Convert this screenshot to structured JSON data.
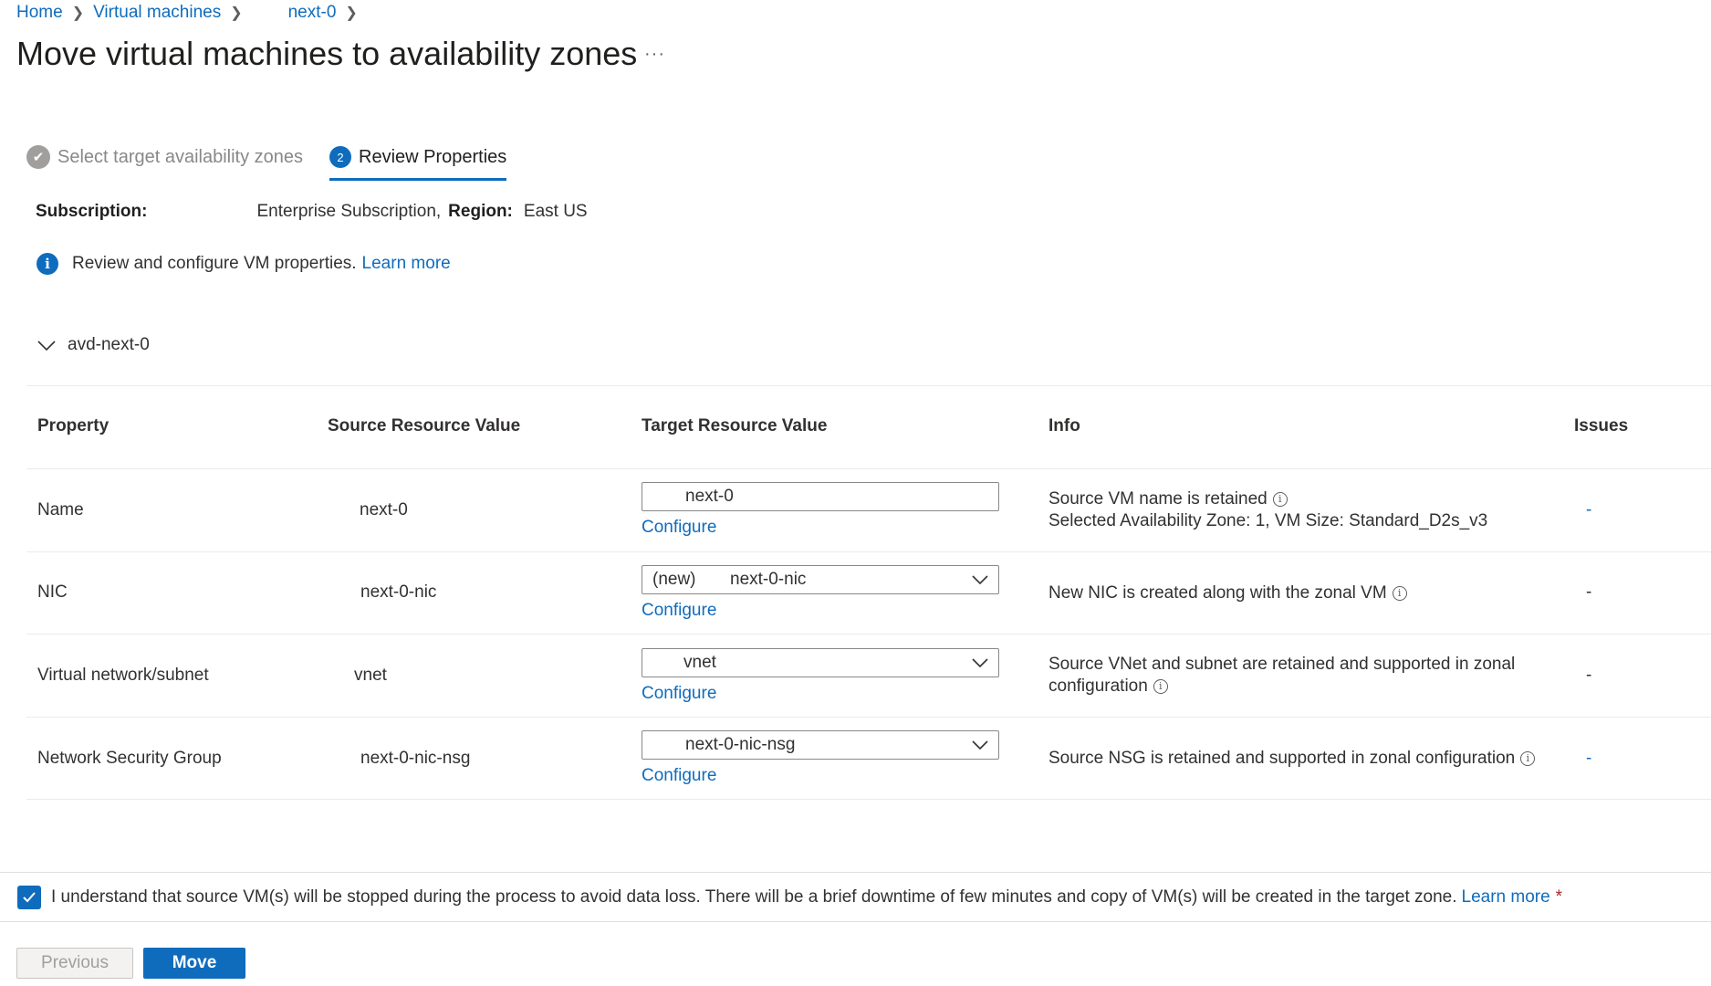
{
  "breadcrumb": {
    "home": "Home",
    "virtual_machines": "Virtual machines",
    "vm": "next-0"
  },
  "page": {
    "title": "Move virtual machines to availability zones",
    "more": "···"
  },
  "wizard": {
    "step1": {
      "label": "Select target availability zones",
      "status": "completed"
    },
    "step2": {
      "label": "Review Properties",
      "number": "2",
      "status": "active"
    }
  },
  "subscription": {
    "label": "Subscription:",
    "value": "Enterprise Subscription,",
    "region_label": "Region:",
    "region_value": "East US"
  },
  "info_banner": {
    "text": "Review and configure VM properties.",
    "link": "Learn more"
  },
  "group": {
    "name": "avd-next-0"
  },
  "table": {
    "headers": {
      "property": "Property",
      "source": "Source Resource Value",
      "target": "Target Resource Value",
      "info": "Info",
      "issues": "Issues"
    },
    "configure_label": "Configure",
    "rows": [
      {
        "property": "Name",
        "source": "next-0",
        "target_value": "next-0",
        "target_prefix": "",
        "info_line1": "Source VM name is retained",
        "info_line2": "Selected Availability Zone: 1, VM Size: Standard_D2s_v3",
        "issues": "-"
      },
      {
        "property": "NIC",
        "source": "next-0-nic",
        "target_value": "next-0-nic",
        "target_prefix": "(new)",
        "info_line1": "New NIC is created along with the zonal VM",
        "info_line2": "",
        "issues": "-"
      },
      {
        "property": "Virtual network/subnet",
        "source": "vnet",
        "target_value": "vnet",
        "target_prefix": "",
        "info_line1": "Source VNet and subnet are retained and supported in zonal",
        "info_line2": "configuration",
        "issues": "-"
      },
      {
        "property": "Network Security Group",
        "source": "next-0-nic-nsg",
        "target_value": "next-0-nic-nsg",
        "target_prefix": "",
        "info_line1": "Source NSG is retained and supported in zonal configuration",
        "info_line2": "",
        "issues": "-"
      }
    ]
  },
  "footer": {
    "acknowledgement": "I understand that source VM(s) will be stopped during the process to avoid data loss. There will be a brief downtime of few minutes and copy of VM(s) will be created in the target zone.",
    "learn_more": "Learn more",
    "required_mark": "*",
    "checkbox_checked": true,
    "previous_label": "Previous",
    "move_label": "Move"
  },
  "colors": {
    "accent": "#0f6cbd",
    "text": "#323130",
    "disabled": "#a19f9d"
  }
}
